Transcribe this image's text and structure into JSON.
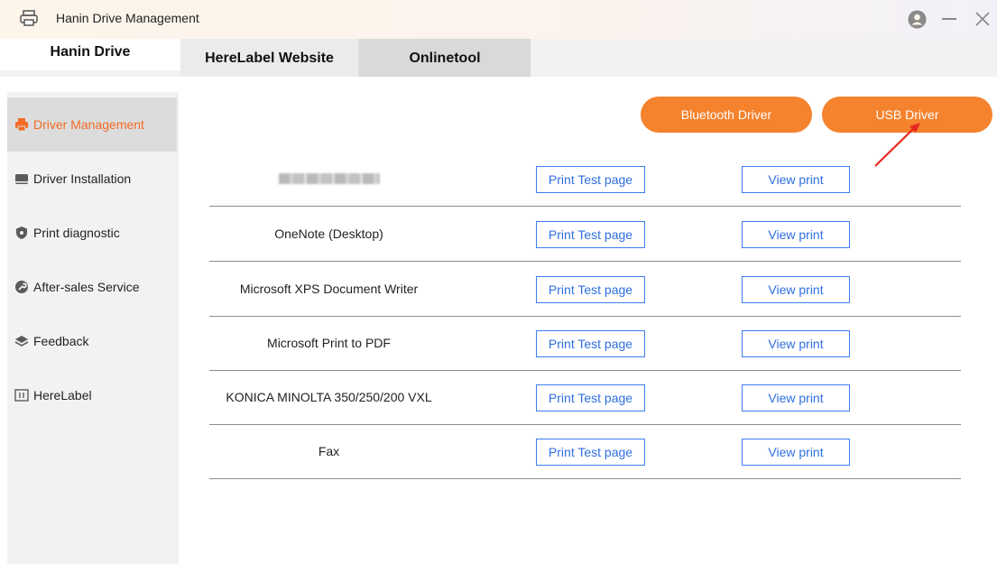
{
  "window": {
    "title": "Hanin Drive Management"
  },
  "tabs": [
    {
      "label": "Hanin Drive"
    },
    {
      "label": "HereLabel Website"
    },
    {
      "label": "Onlinetool"
    }
  ],
  "sidebar": {
    "items": [
      {
        "label": "Driver Management",
        "icon": "printer-icon"
      },
      {
        "label": "Driver Installation",
        "icon": "install-icon"
      },
      {
        "label": "Print diagnostic",
        "icon": "shield-icon"
      },
      {
        "label": "After-sales Service",
        "icon": "wrench-icon"
      },
      {
        "label": "Feedback",
        "icon": "layers-icon"
      },
      {
        "label": "HereLabel",
        "icon": "grid-icon"
      }
    ]
  },
  "actions": {
    "bluetooth_label": "Bluetooth Driver",
    "usb_label": "USB Driver"
  },
  "printers": [
    {
      "name": "",
      "test_label": "Print Test page",
      "view_label": "View print"
    },
    {
      "name": "OneNote (Desktop)",
      "test_label": "Print Test page",
      "view_label": "View print"
    },
    {
      "name": "Microsoft XPS Document Writer",
      "test_label": "Print Test page",
      "view_label": "View print"
    },
    {
      "name": "Microsoft Print to PDF",
      "test_label": "Print Test page",
      "view_label": "View print"
    },
    {
      "name": "KONICA MINOLTA 350/250/200 VXL",
      "test_label": "Print Test page",
      "view_label": "View print"
    },
    {
      "name": "Fax",
      "test_label": "Print Test page",
      "view_label": "View print"
    }
  ],
  "colors": {
    "accent": "#f5822d",
    "active_text": "#f36b24",
    "link_blue": "#2f6fe0",
    "arrow_red": "#e8281e"
  }
}
